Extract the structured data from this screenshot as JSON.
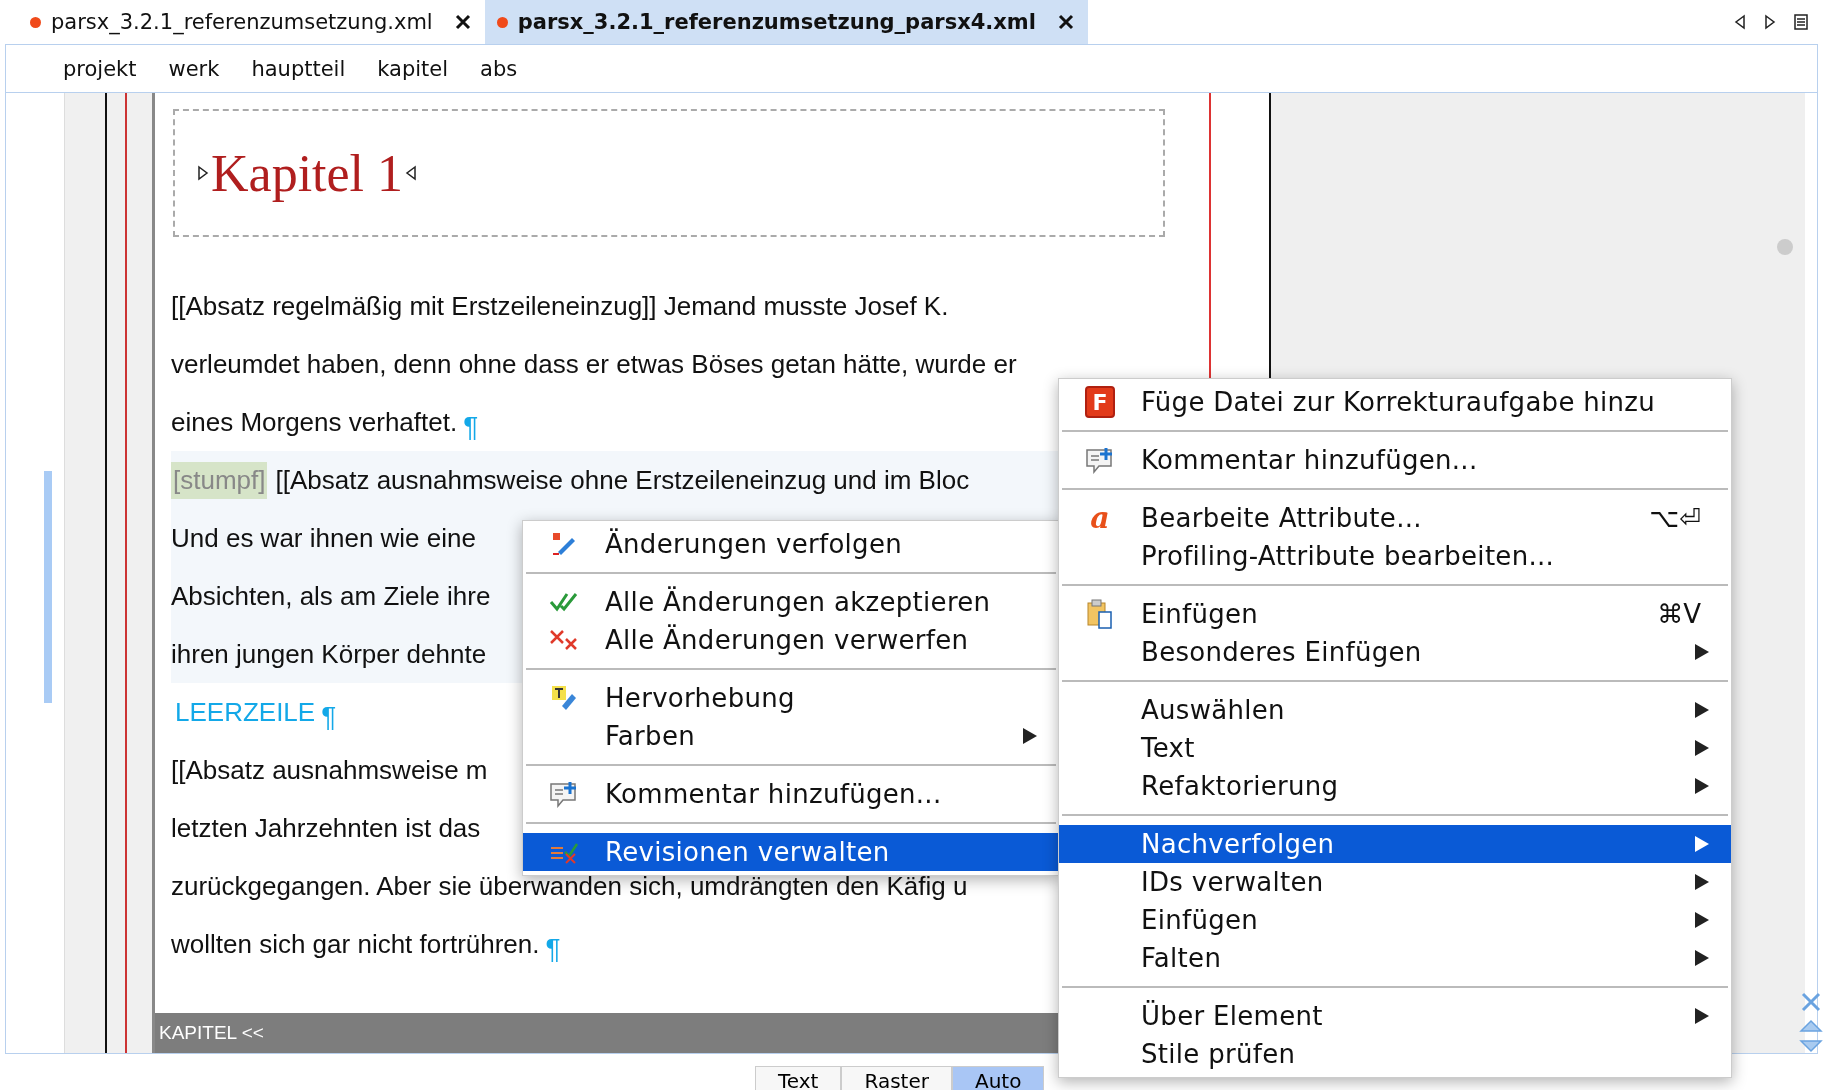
{
  "tabs": [
    {
      "label": "parsx_3.2.1_referenzumsetzung.xml",
      "modified": true,
      "selected": false
    },
    {
      "label": "parsx_3.2.1_referenzumsetzung_parsx4.xml",
      "modified": true,
      "selected": true
    }
  ],
  "breadcrumb": [
    "projekt",
    "werk",
    "hauptteil",
    "kapitel",
    "abs"
  ],
  "editor": {
    "title": "Kapitel 1",
    "lines": [
      {
        "kind": "text",
        "text": "[[Absatz regelmäßig mit Erstzeileneinzug]] Jemand musste Josef K.",
        "pilcrow": false,
        "highlighted": false
      },
      {
        "kind": "text",
        "text": "verleumdet haben, denn ohne dass er etwas Böses getan hätte, wurde er",
        "pilcrow": false,
        "highlighted": false
      },
      {
        "kind": "text",
        "text": "eines Morgens verhaftet.",
        "pilcrow": true,
        "highlighted": false
      },
      {
        "kind": "text",
        "tag": "[stumpf]",
        "text": "[[Absatz ausnahmsweise ohne Erstzeileneinzug und im Bloc",
        "pilcrow": false,
        "highlighted": true
      },
      {
        "kind": "text",
        "text": "Und es war ihnen wie eine",
        "pilcrow": false,
        "highlighted": true
      },
      {
        "kind": "text",
        "text": "Absichten, als am Ziele ihre",
        "pilcrow": false,
        "highlighted": true
      },
      {
        "kind": "text",
        "text": "ihren jungen Körper dehnte",
        "pilcrow": false,
        "highlighted": true
      },
      {
        "kind": "blank",
        "text": "LEERZEILE",
        "pilcrow": true,
        "highlighted": false
      },
      {
        "kind": "text",
        "text": "[[Absatz ausnahmsweise m",
        "pilcrow": false,
        "highlighted": false
      },
      {
        "kind": "text",
        "text": "letzten Jahrzehnten ist das",
        "pilcrow": false,
        "highlighted": false
      },
      {
        "kind": "text",
        "text": "zurückgegangen. Aber sie überwanden sich, umdrängten den Käfig u",
        "pilcrow": false,
        "highlighted": false
      },
      {
        "kind": "text",
        "text": "wollten sich gar nicht fortrühren.",
        "pilcrow": true,
        "highlighted": false
      }
    ],
    "pilcrow": "¶",
    "status": "KAPITEL <<"
  },
  "view_tabs": [
    {
      "label": "Text",
      "selected": false
    },
    {
      "label": "Raster",
      "selected": false
    },
    {
      "label": "Auto",
      "selected": true
    }
  ],
  "submenu": [
    [
      {
        "label": "Änderungen verfolgen",
        "kind": "track",
        "selected": false,
        "submenu": false
      }
    ],
    [
      {
        "label": "Alle Änderungen akzeptieren",
        "kind": "accept",
        "selected": false,
        "submenu": false
      },
      {
        "label": "Alle Änderungen verwerfen",
        "kind": "reject",
        "selected": false,
        "submenu": false
      }
    ],
    [
      {
        "label": "Hervorhebung",
        "kind": "highlight",
        "selected": false,
        "submenu": false
      },
      {
        "label": "Farben",
        "kind": "plain",
        "selected": false,
        "submenu": true
      }
    ],
    [
      {
        "label": "Kommentar hinzufügen...",
        "kind": "comment",
        "selected": false,
        "submenu": false
      }
    ],
    [
      {
        "label": "Revisionen verwalten",
        "kind": "revisions",
        "selected": true,
        "submenu": false
      }
    ]
  ],
  "menu": [
    [
      {
        "label": "Füge Datei zur Korrekturaufgabe hinzu",
        "kind": "badge",
        "glyph": "F",
        "selected": false,
        "submenu": false
      }
    ],
    [
      {
        "label": "Kommentar hinzufügen...",
        "kind": "comment",
        "selected": false,
        "submenu": false
      }
    ],
    [
      {
        "label": "Bearbeite Attribute...",
        "kind": "letter",
        "glyph": "a",
        "shortcut": "⌥⏎",
        "selected": false,
        "submenu": false
      },
      {
        "label": "Profiling-Attribute bearbeiten...",
        "kind": "plain",
        "selected": false,
        "submenu": false
      }
    ],
    [
      {
        "label": "Einfügen",
        "kind": "paste",
        "shortcut": "⌘V",
        "selected": false,
        "submenu": false
      },
      {
        "label": "Besonderes Einfügen",
        "kind": "plain",
        "selected": false,
        "submenu": true
      }
    ],
    [
      {
        "label": "Auswählen",
        "kind": "plain",
        "selected": false,
        "submenu": true
      },
      {
        "label": "Text",
        "kind": "plain",
        "selected": false,
        "submenu": true
      },
      {
        "label": "Refaktorierung",
        "kind": "plain",
        "selected": false,
        "submenu": true
      }
    ],
    [
      {
        "label": "Nachverfolgen",
        "kind": "plain",
        "selected": true,
        "submenu": true
      },
      {
        "label": "IDs verwalten",
        "kind": "plain",
        "selected": false,
        "submenu": true
      },
      {
        "label": "Einfügen",
        "kind": "plain",
        "selected": false,
        "submenu": true
      },
      {
        "label": "Falten",
        "kind": "plain",
        "selected": false,
        "submenu": true
      }
    ],
    [
      {
        "label": "Über Element",
        "kind": "plain",
        "selected": false,
        "submenu": true
      },
      {
        "label": "Stile prüfen",
        "kind": "plain",
        "selected": false,
        "submenu": false
      }
    ]
  ]
}
